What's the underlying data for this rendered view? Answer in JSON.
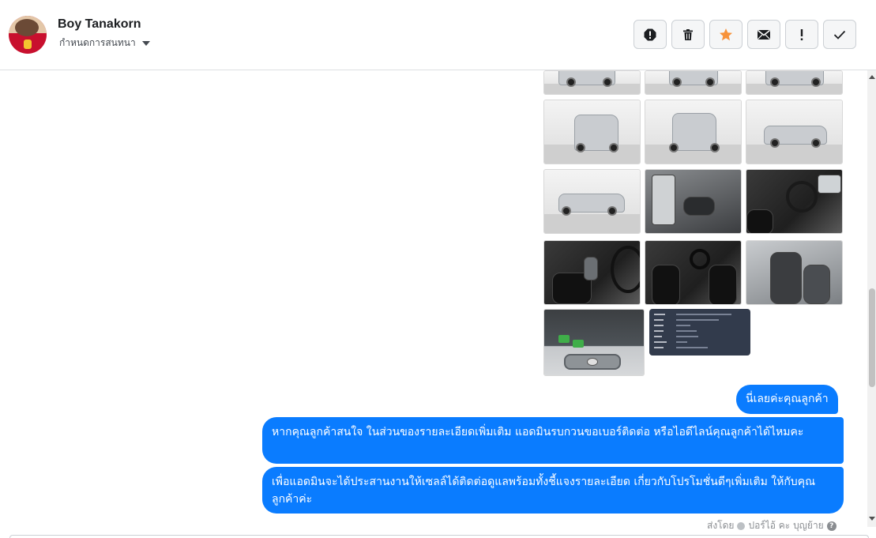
{
  "header": {
    "contact_name": "Boy Tanakorn",
    "status_label": "กำหนดการสนทนา",
    "toolbar": [
      {
        "name": "report-icon",
        "label": "report"
      },
      {
        "name": "trash-icon",
        "label": "delete"
      },
      {
        "name": "star-icon",
        "label": "star"
      },
      {
        "name": "envelope-icon",
        "label": "mark unread"
      },
      {
        "name": "exclamation-icon",
        "label": "spam"
      },
      {
        "name": "check-icon",
        "label": "done"
      }
    ]
  },
  "colors": {
    "bubble": "#0a7cff",
    "star": "#f7923a",
    "spec_card": "#323b4c"
  },
  "photos": [
    {
      "name": "photo-front-left-partial"
    },
    {
      "name": "photo-front-partial"
    },
    {
      "name": "photo-rear-left-partial"
    },
    {
      "name": "photo-front-left"
    },
    {
      "name": "photo-rear"
    },
    {
      "name": "photo-side-right"
    },
    {
      "name": "photo-side-left"
    },
    {
      "name": "photo-door-interior"
    },
    {
      "name": "photo-dashboard-steering"
    },
    {
      "name": "photo-gear-console"
    },
    {
      "name": "photo-front-seats"
    },
    {
      "name": "photo-rear-seats"
    },
    {
      "name": "photo-engine-bay"
    },
    {
      "name": "photo-spec-sheet"
    }
  ],
  "messages": [
    {
      "text": "นี่เลยค่ะคุณลูกค้า"
    },
    {
      "text": "หากคุณลูกค้าสนใจ ในส่วนของรายละเอียดเพิ่มเติม แอดมินรบกวนขอเบอร์ติดต่อ หรือไอดีไลน์คุณลูกค้าได้ไหมคะ"
    },
    {
      "text": "เพื่อแอดมินจะได้ประสานงานให้เซลล์ได้ติดต่อดูแลพร้อมทั้งชี้แจงรายละเอียด เกี่ยวกับโปรโมชั่นดีๆเพิ่มเติม ให้กับคุณลูกค้าค่ะ"
    }
  ],
  "sent_by": {
    "prefix": "ส่งโดย",
    "name": "ปอร์ไอ้ คะ บุญย้าย"
  }
}
